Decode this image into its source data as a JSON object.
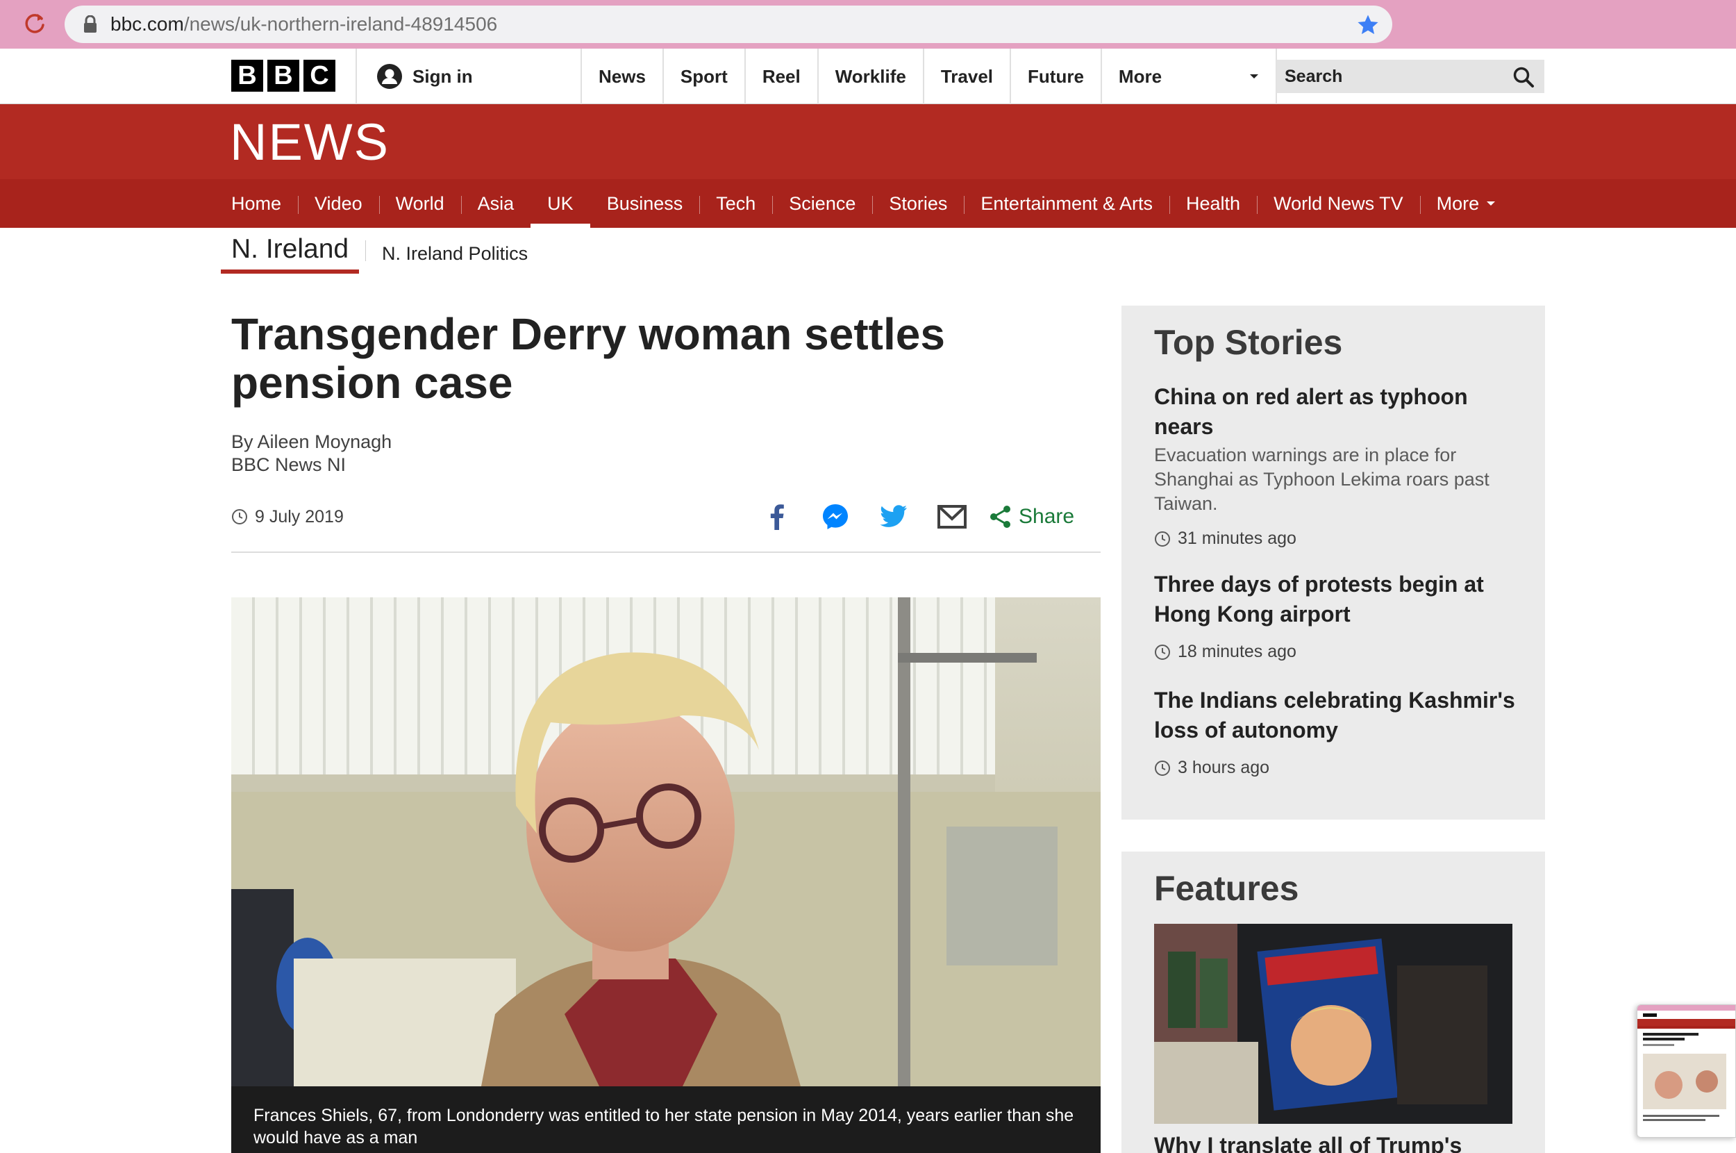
{
  "browser": {
    "url_host": "bbc.com",
    "url_path": "/news/uk-northern-ireland-48914506"
  },
  "masthead": {
    "logo_letters": [
      "B",
      "B",
      "C"
    ],
    "signin_label": "Sign in",
    "nav": [
      "News",
      "Sport",
      "Reel",
      "Worklife",
      "Travel",
      "Future"
    ],
    "more_label": "More",
    "search_placeholder": "Search"
  },
  "banner": {
    "title": "NEWS",
    "color": "#b22a22"
  },
  "section_nav": {
    "items": [
      "Home",
      "Video",
      "World",
      "Asia",
      "UK",
      "Business",
      "Tech",
      "Science",
      "Stories",
      "Entertainment & Arts",
      "Health",
      "World News TV"
    ],
    "active": "UK",
    "more_label": "More"
  },
  "sub_nav": {
    "current": "N. Ireland",
    "link": "N. Ireland Politics"
  },
  "article": {
    "title": "Transgender Derry woman settles pension case",
    "byline_author": "By Aileen Moynagh",
    "byline_outlet": "BBC News NI",
    "date": "9 July 2019",
    "share_label": "Share",
    "share_icons": [
      "facebook-icon",
      "messenger-icon",
      "twitter-icon",
      "email-icon",
      "share-icon"
    ],
    "image_caption": "Frances Shiels, 67, from Londonderry was entitled to her state pension in May 2014, years earlier than she would have as a man"
  },
  "top_stories": {
    "heading": "Top Stories",
    "items": [
      {
        "headline": "China on red alert as typhoon nears",
        "summary": "Evacuation warnings are in place for Shanghai as Typhoon Lekima roars past Taiwan.",
        "time": "31 minutes ago"
      },
      {
        "headline": "Three days of protests begin at Hong Kong airport",
        "summary": "",
        "time": "18 minutes ago"
      },
      {
        "headline": "The Indians celebrating Kashmir's loss of autonomy",
        "summary": "",
        "time": "3 hours ago"
      }
    ]
  },
  "features": {
    "heading": "Features",
    "headline": "Why I translate all of Trump's"
  },
  "colors": {
    "browser_bar": "#e4a1c1",
    "bbc_red": "#b22a22",
    "section_nav": "#a8231c",
    "share_green": "#1a7a39",
    "facebook": "#3b5998",
    "messenger": "#0084ff",
    "twitter": "#1da1f2"
  }
}
